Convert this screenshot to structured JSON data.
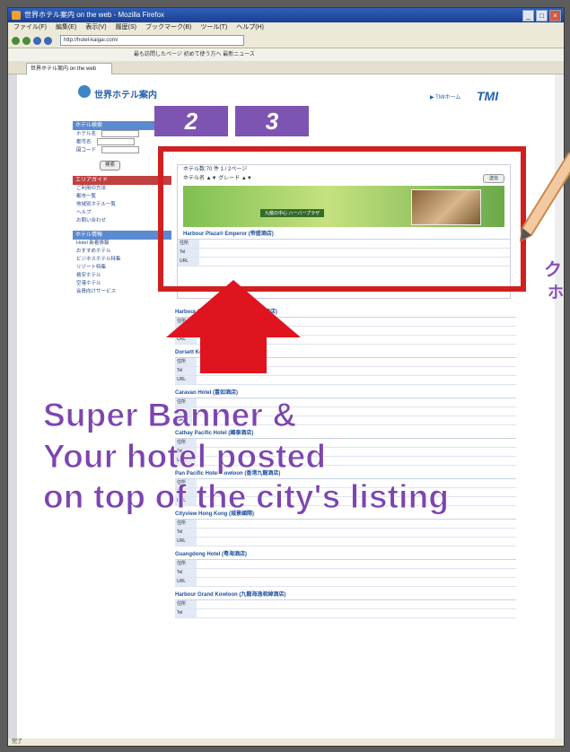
{
  "browser": {
    "title": "世界ホテル案内 on the web - Mozilla Firefox",
    "menus": [
      "ファイル(F)",
      "編集(E)",
      "表示(V)",
      "履歴(S)",
      "ブックマーク(B)",
      "ツール(T)",
      "ヘルプ(H)"
    ],
    "url": "http://hotel-kaigai.com/",
    "bookmarks": "最も訪問したページ  初めて使う方へ  最新ニュース",
    "tab_label": "世界ホテル案内 on the web",
    "status": "完了"
  },
  "site": {
    "logo_text": "世界ホテル案内",
    "brand": "TMI",
    "top_link": "▶ TMIホーム"
  },
  "sidebar": {
    "search_title": "ホテル検索",
    "fields": [
      "ホテル名",
      "都市名",
      "国コード"
    ],
    "search_button": "検索",
    "area_title": "エリアガイド",
    "area_items": [
      "ご利用の方法",
      "都市一覧",
      "地域別ホテル一覧",
      "ヘルプ",
      "お問い合わせ"
    ],
    "info_title": "ホテル情報",
    "info_items": [
      "Hotel 新着情報",
      "おすすめホテル",
      "ビジネスホテル特集",
      "リゾート特集",
      "格安ホテル",
      "空港ホテル",
      "会員向けサービス"
    ]
  },
  "featured": {
    "header": "ホテル数:70 件  1 / 2ページ",
    "sub": "ホテル名 ▲▼  グレード ▲▼",
    "sort_button": "送信",
    "banner_caption": "九龍の中心 ハーバープラザ",
    "hotel_name": "Harbour Plaza® Emperor (帝盛酒店)"
  },
  "listings": [
    "Harbour Plaza Metropolis (都会海逸酒店)",
    "Dorsett Kowloon (帝都酒店)",
    "Caravan Hotel (富如酒店)",
    "Cathay Pacific Hotel (國泰酒店)",
    "Pan Pacific Hotel Kowloon (香港九龍酒店)",
    "Cityview Hong Kong (城景國際)",
    "Guangdong Hotel (粤海酒店)",
    "Harbour Grand Kowloon (九龍海逸君綽酒店)"
  ],
  "tabs": {
    "step2": "2",
    "step3": "3"
  },
  "caption": {
    "line1": "Super Banner &",
    "line2": "Your hotel posted",
    "line3": "on top of the city's listing"
  },
  "jp_partial": {
    "a": "ク",
    "b": "ホ"
  },
  "colors": {
    "accent_purple": "#7d45b0",
    "highlight_red": "#d02020"
  }
}
